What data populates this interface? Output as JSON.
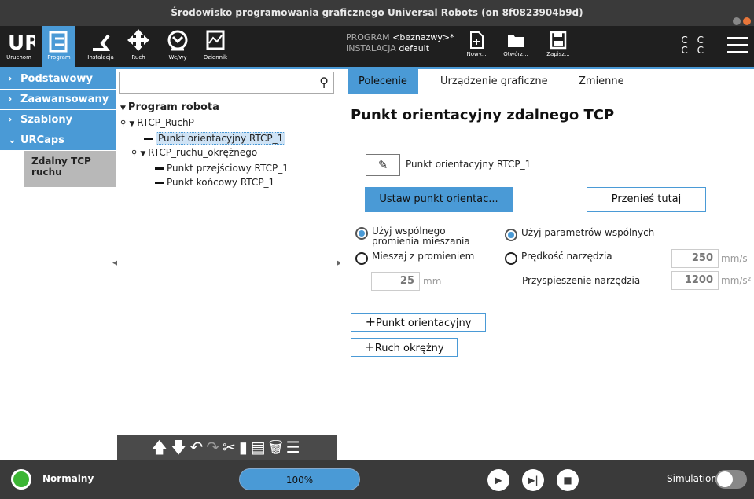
{
  "window": {
    "title": "Środowisko programowania graficznego Universal Robots (on 8f0823904b9d)"
  },
  "topbar": {
    "buttons": [
      {
        "label": "Uruchom",
        "icon": "ur-logo-icon"
      },
      {
        "label": "Program",
        "icon": "program-icon"
      },
      {
        "label": "Instalacja",
        "icon": "installation-icon"
      },
      {
        "label": "Ruch",
        "icon": "move-icon"
      },
      {
        "label": "We/wy",
        "icon": "io-icon"
      },
      {
        "label": "Dziennik",
        "icon": "log-icon"
      }
    ],
    "program_label": "PROGRAM",
    "program_value": "<beznazwy>*",
    "installation_label": "INSTALACJA",
    "installation_value": "default",
    "file_buttons": [
      {
        "label": "Nowy...",
        "icon": "new-file-icon"
      },
      {
        "label": "Otwórz...",
        "icon": "open-folder-icon"
      },
      {
        "label": "Zapisz...",
        "icon": "save-icon"
      }
    ],
    "cc": [
      "C C",
      "C C"
    ]
  },
  "sidebar": {
    "items": [
      {
        "label": "Podstawowy",
        "chevron": "›"
      },
      {
        "label": "Zaawansowany",
        "chevron": "›"
      },
      {
        "label": "Szablony",
        "chevron": "›"
      },
      {
        "label": "URCaps",
        "chevron": "⌄"
      }
    ],
    "subitem": "Zdalny TCP ruchu"
  },
  "tree": {
    "search_placeholder": "",
    "root": "Program robota",
    "nodes": [
      {
        "label": "RTCP_RuchP"
      },
      {
        "label": "Punkt orientacyjny RTCP_1"
      },
      {
        "label": "RTCP_ruchu_okrężnego"
      },
      {
        "label": "Punkt przejściowy RTCP_1"
      },
      {
        "label": "Punkt końcowy RTCP_1"
      }
    ]
  },
  "main": {
    "tabs": [
      "Polecenie",
      "Urządzenie graficzne",
      "Zmienne"
    ],
    "heading": "Punkt orientacyjny zdalnego TCP",
    "name_value": "Punkt orientacyjny RTCP_1",
    "set_point_button": "Ustaw punkt orientac...",
    "move_here_button": "Przenieś tutaj",
    "radio_shared_blend": "Użyj wspólnego promienia mieszania",
    "radio_blend_radius": "Mieszaj z promieniem",
    "blend_value": "25",
    "blend_unit": "mm",
    "radio_shared_params": "Użyj parametrów wspólnych",
    "radio_tool_speed": "Prędkość narzędzia",
    "tool_speed_value": "250",
    "tool_speed_unit": "mm/s",
    "tool_accel_label": "Przyspieszenie narzędzia",
    "tool_accel_value": "1200",
    "tool_accel_unit": "mm/s²",
    "add_waypoint_button": "Punkt orientacyjny",
    "add_circle_button": "Ruch okrężny"
  },
  "bottombar": {
    "status": "Normalny",
    "speed": "100%",
    "simulation_label": "Simulation"
  },
  "colors": {
    "accent": "#4a9ad6",
    "status_ok": "#3cb534",
    "dark": "#1f1f1f"
  }
}
